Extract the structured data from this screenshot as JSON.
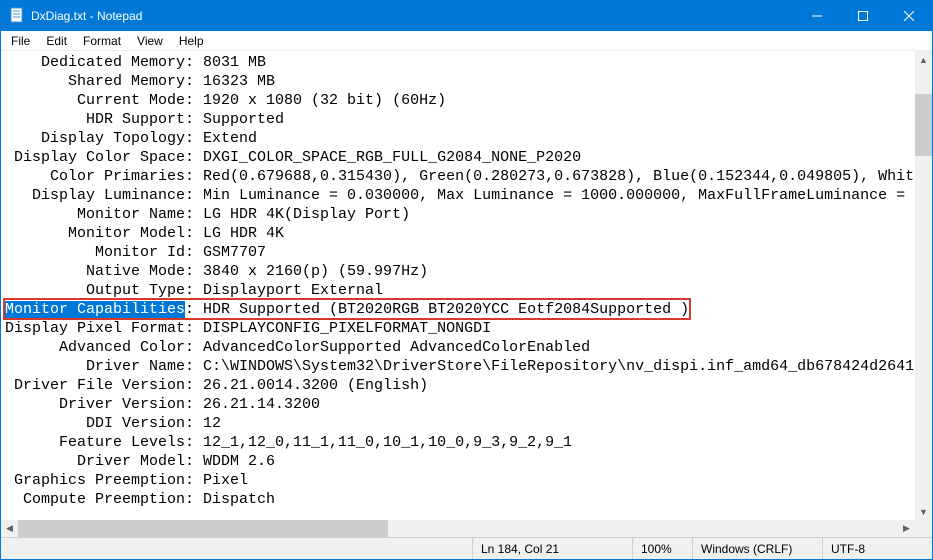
{
  "window": {
    "title": "DxDiag.txt - Notepad"
  },
  "menu": {
    "file": "File",
    "edit": "Edit",
    "format": "Format",
    "view": "View",
    "help": "Help"
  },
  "content": {
    "lines": [
      {
        "label": "Dedicated Memory",
        "value": "8031 MB"
      },
      {
        "label": "Shared Memory",
        "value": "16323 MB"
      },
      {
        "label": "Current Mode",
        "value": "1920 x 1080 (32 bit) (60Hz)"
      },
      {
        "label": "HDR Support",
        "value": "Supported"
      },
      {
        "label": "Display Topology",
        "value": "Extend"
      },
      {
        "label": "Display Color Space",
        "value": "DXGI_COLOR_SPACE_RGB_FULL_G2084_NONE_P2020"
      },
      {
        "label": "Color Primaries",
        "value": "Red(0.679688,0.315430), Green(0.280273,0.673828), Blue(0.152344,0.049805), Whit"
      },
      {
        "label": "Display Luminance",
        "value": "Min Luminance = 0.030000, Max Luminance = 1000.000000, MaxFullFrameLuminance = "
      },
      {
        "label": "Monitor Name",
        "value": "LG HDR 4K(Display Port)"
      },
      {
        "label": "Monitor Model",
        "value": "LG HDR 4K"
      },
      {
        "label": "Monitor Id",
        "value": "GSM7707"
      },
      {
        "label": "Native Mode",
        "value": "3840 x 2160(p) (59.997Hz)"
      },
      {
        "label": "Output Type",
        "value": "Displayport External"
      },
      {
        "label": "Monitor Capabilities",
        "value": "HDR Supported (BT2020RGB BT2020YCC Eotf2084Supported )",
        "highlighted": true
      },
      {
        "label": "Display Pixel Format",
        "value": "DISPLAYCONFIG_PIXELFORMAT_NONGDI"
      },
      {
        "label": "Advanced Color",
        "value": "AdvancedColorSupported AdvancedColorEnabled"
      },
      {
        "label": "Driver Name",
        "value": "C:\\WINDOWS\\System32\\DriverStore\\FileRepository\\nv_dispi.inf_amd64_db678424d2641"
      },
      {
        "label": "Driver File Version",
        "value": "26.21.0014.3200 (English)"
      },
      {
        "label": "Driver Version",
        "value": "26.21.14.3200"
      },
      {
        "label": "DDI Version",
        "value": "12"
      },
      {
        "label": "Feature Levels",
        "value": "12_1,12_0,11_1,11_0,10_1,10_0,9_3,9_2,9_1"
      },
      {
        "label": "Driver Model",
        "value": "WDDM 2.6"
      },
      {
        "label": "Graphics Preemption",
        "value": "Pixel"
      },
      {
        "label": "Compute Preemption",
        "value": "Dispatch"
      }
    ],
    "label_col_width": 20
  },
  "status": {
    "position": "Ln 184, Col 21",
    "zoom": "100%",
    "line_ending": "Windows (CRLF)",
    "encoding": "UTF-8"
  }
}
